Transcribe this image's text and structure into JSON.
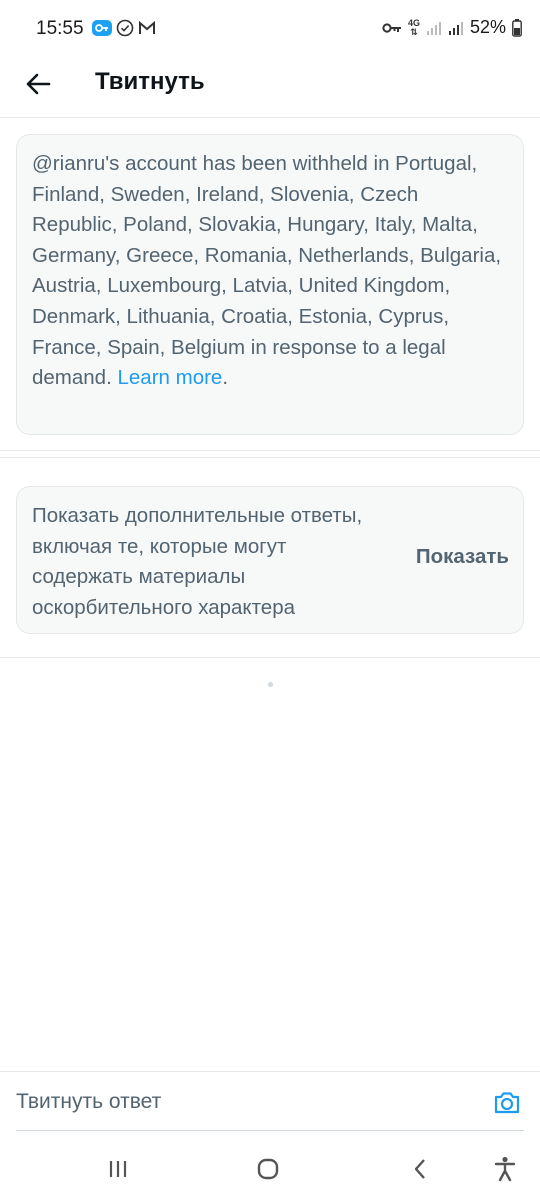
{
  "status_bar": {
    "time": "15:55",
    "battery": "52%",
    "network": "4G",
    "icons": [
      "vpn-key-icon",
      "check-circle-icon",
      "gmail-icon",
      "key-icon",
      "signal-icon",
      "battery-icon"
    ]
  },
  "header": {
    "title": "Твитнуть",
    "back_icon": "arrow-left-icon"
  },
  "withheld_notice": {
    "text": "@rianru's account has been withheld in Portugal, Finland, Sweden, Ireland, Slovenia, Czech Republic, Poland, Slovakia, Hungary, Italy, Malta, Germany, Greece, Romania, Netherlands, Bulgaria, Austria, Luxembourg, Latvia, United Kingdom, Denmark, Lithuania, Croatia, Estonia, Cyprus, France, Spain, Belgium in response to a legal demand.",
    "link_label": "Learn more",
    "suffix": "."
  },
  "sensitive_replies": {
    "text": "Показать дополнительные ответы, включая те, которые могут содержать материалы оскорбительного характера",
    "button_label": "Показать"
  },
  "reply_bar": {
    "placeholder": "Твитнуть ответ",
    "value": "",
    "camera_icon": "camera-icon"
  },
  "nav_bar": {
    "icons": [
      "recent-apps-icon",
      "home-icon",
      "back-icon",
      "accessibility-icon"
    ]
  },
  "colors": {
    "link": "#1d9bf0",
    "secondary_text": "#536471",
    "card_bg": "#f7f9f9"
  }
}
